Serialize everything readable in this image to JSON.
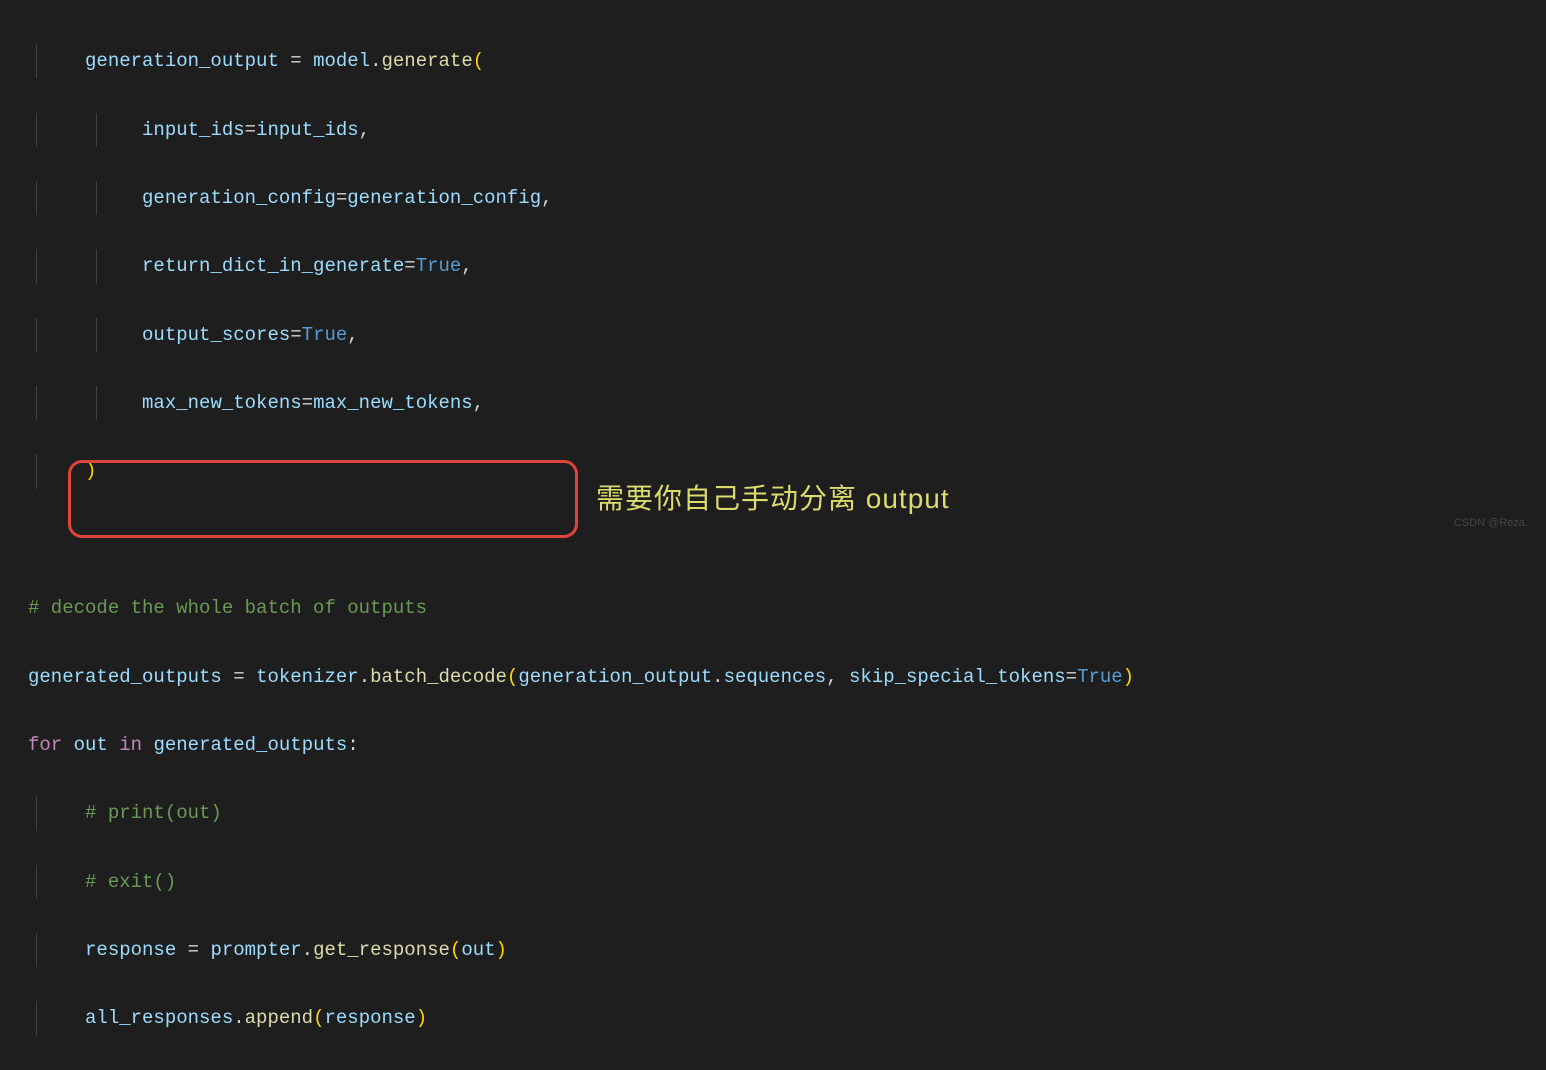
{
  "code": {
    "l1_var": "generation_output",
    "l1_obj": "model",
    "l1_func": "generate",
    "l2_param": "input_ids",
    "l2_val": "input_ids",
    "l3_param": "generation_config",
    "l3_val": "generation_config",
    "l4_param": "return_dict_in_generate",
    "l4_val": "True",
    "l5_param": "output_scores",
    "l5_val": "True",
    "l6_param": "max_new_tokens",
    "l6_val": "max_new_tokens",
    "l8_comment": "# decode the whole batch of outputs",
    "l9_var": "generated_outputs",
    "l9_obj": "tokenizer",
    "l9_func": "batch_decode",
    "l9_arg1a": "generation_output",
    "l9_arg1b": "sequences",
    "l9_kw": "skip_special_tokens",
    "l9_kwval": "True",
    "l10_kw1": "for",
    "l10_var": "out",
    "l10_kw2": "in",
    "l10_iter": "generated_outputs",
    "l11_comment": "# print(out)",
    "l12_comment": "# exit()",
    "l13_var": "response",
    "l13_obj": "prompter",
    "l13_func": "get_response",
    "l13_arg": "out",
    "l14_obj": "all_responses",
    "l14_func": "append",
    "l14_arg": "response"
  },
  "annotation": "需要你自己手动分离 output",
  "watermark": "CSDN @Reza."
}
